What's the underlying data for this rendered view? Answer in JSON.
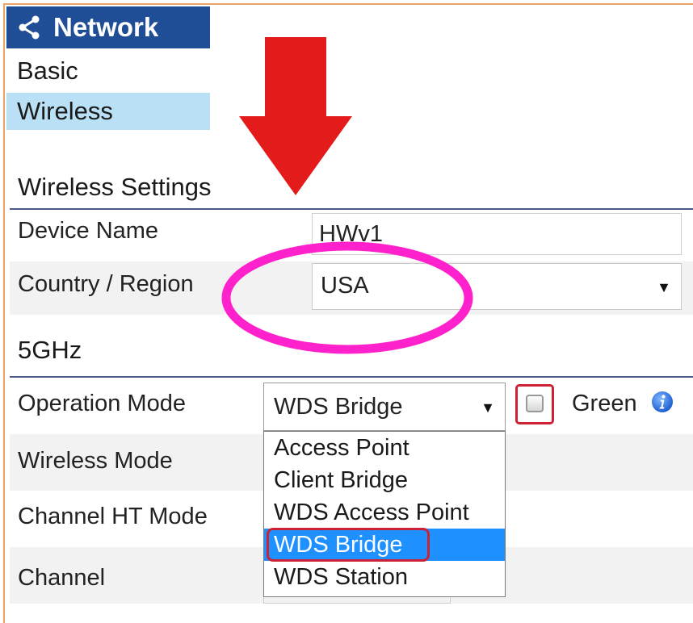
{
  "sidebar": {
    "header_title": "Network",
    "items": [
      {
        "label": "Basic",
        "selected": false
      },
      {
        "label": "Wireless",
        "selected": true
      }
    ]
  },
  "wireless_settings": {
    "title": "Wireless Settings",
    "device_name_label": "Device Name",
    "device_name_value": "HWv1",
    "country_label": "Country / Region",
    "country_value": "USA"
  },
  "band": {
    "title": "5GHz",
    "operation_mode_label": "Operation Mode",
    "operation_mode_value": "WDS Bridge",
    "operation_mode_options": [
      "Access Point",
      "Client Bridge",
      "WDS Access Point",
      "WDS Bridge",
      "WDS Station"
    ],
    "operation_mode_selected_index": 3,
    "green_label": "Green",
    "green_checked": false,
    "wireless_mode_label": "Wireless Mode",
    "channel_ht_mode_label": "Channel HT Mode",
    "channel_label": "Channel"
  },
  "icons": {
    "share": "share-icon",
    "info": "info-icon",
    "caret": "caret-down-icon"
  },
  "colors": {
    "header_bg": "#1f4e96",
    "selected_nav_bg": "#b9e0f4",
    "dropdown_highlight": "#1e90ff",
    "annotation_red": "#cc2233",
    "annotation_pink": "#ff22cc",
    "arrow_red": "#e41b1b"
  }
}
